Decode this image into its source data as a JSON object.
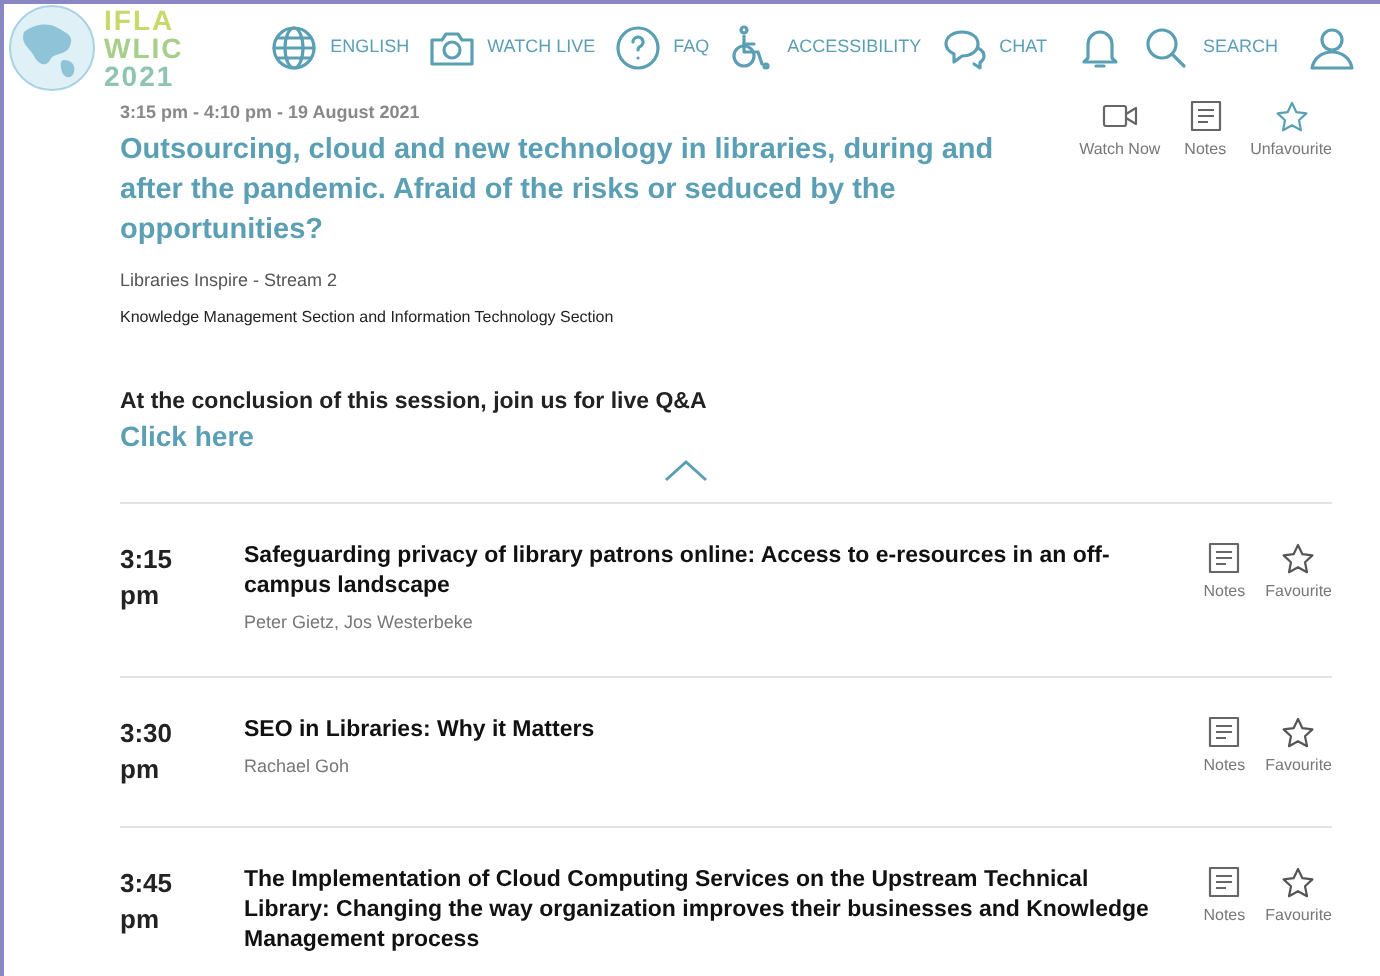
{
  "logo": {
    "lines": [
      "IFLA",
      "WLIC",
      "2021"
    ]
  },
  "nav": [
    {
      "kind": "globe",
      "label": "ENGLISH"
    },
    {
      "kind": "camera",
      "label": "WATCH LIVE"
    },
    {
      "kind": "help",
      "label": "FAQ"
    },
    {
      "kind": "wheelchair",
      "label": "ACCESSIBILITY"
    },
    {
      "kind": "chat",
      "label": "CHAT"
    },
    {
      "kind": "bell"
    },
    {
      "kind": "search",
      "label": "SEARCH"
    },
    {
      "kind": "user"
    }
  ],
  "session": {
    "time": "3:15 pm - 4:10 pm - 19 August 2021",
    "title": "Outsourcing, cloud and new technology in libraries, during and after the pandemic. Afraid of the risks or seduced by the opportunities?",
    "stream": "Libraries Inspire - Stream 2",
    "sections": "Knowledge Management Section and Information Technology Section",
    "actions": [
      {
        "kind": "video",
        "label": "Watch Now"
      },
      {
        "kind": "notes",
        "label": "Notes"
      },
      {
        "kind": "star",
        "label": "Unfavourite",
        "favourited": true
      }
    ],
    "qa_text": "At the conclusion of this session, join us for live Q&A",
    "qa_link": "Click here",
    "expanded": true
  },
  "talks": [
    {
      "time": "3:15 pm",
      "title": "Safeguarding privacy of library patrons online: Access to e-resources in an off-campus landscape",
      "speakers": "Peter Gietz, Jos Westerbeke",
      "notes": "Notes",
      "fav_label": "Favourite",
      "favourited": false
    },
    {
      "time": "3:30 pm",
      "title": "SEO in Libraries: Why it Matters",
      "speakers": "Rachael Goh",
      "notes": "Notes",
      "fav_label": "Favourite",
      "favourited": false
    },
    {
      "time": "3:45 pm",
      "title": "The Implementation of Cloud Computing Services on the Upstream Technical Library: Changing the way organization improves their businesses and Knowledge Management process",
      "notes": "Notes",
      "fav_label": "Favourite",
      "favourited": false
    }
  ]
}
